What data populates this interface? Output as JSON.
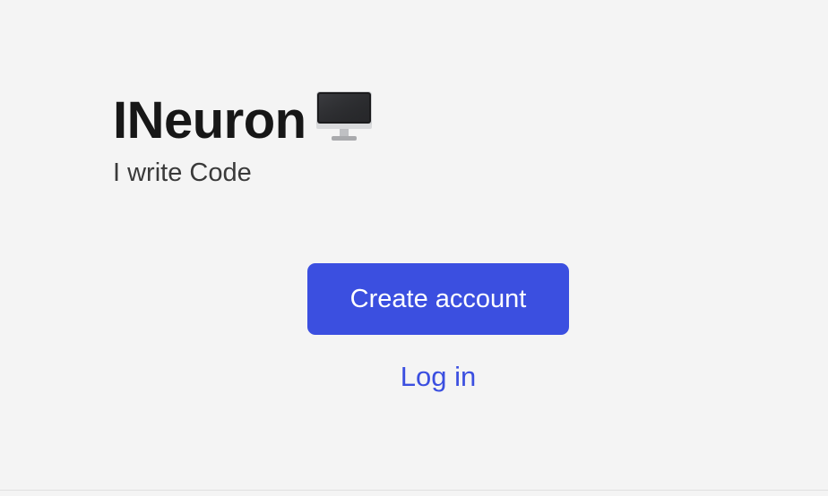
{
  "brand": {
    "title": "INeuron",
    "title_icon": "desktop-computer-icon",
    "tagline": "I write Code"
  },
  "actions": {
    "create_account_label": "Create account",
    "login_label": "Log in"
  },
  "colors": {
    "background": "#f4f4f4",
    "title_text": "#171717",
    "tagline_text": "#3a3a3a",
    "accent": "#3b4fe0",
    "button_text": "#ffffff"
  }
}
